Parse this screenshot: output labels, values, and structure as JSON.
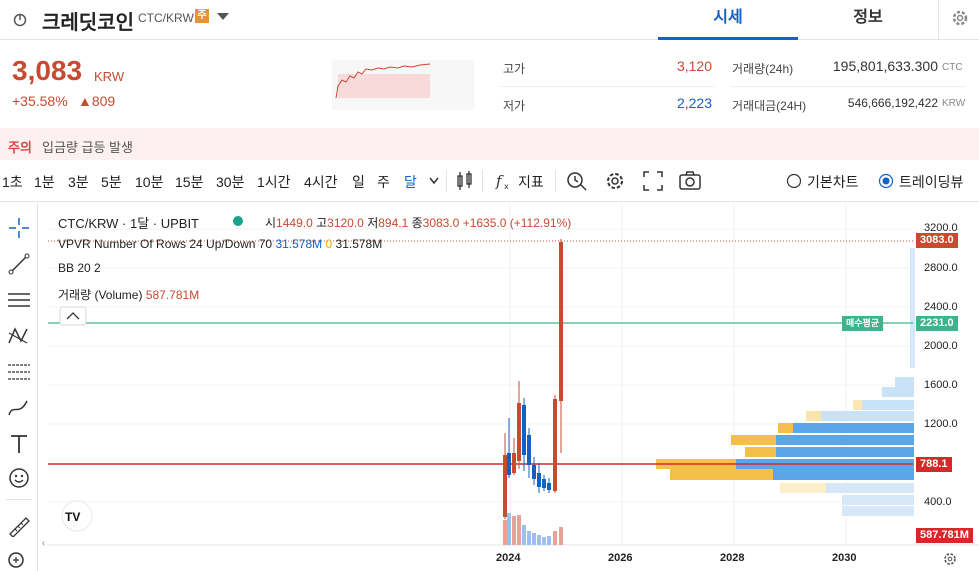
{
  "header": {
    "coin_name": "크레딧코인",
    "pair": "CTC/KRW",
    "badge": "주",
    "tabs": [
      {
        "label": "시세"
      },
      {
        "label": "정보"
      }
    ]
  },
  "ticker": {
    "price": "3,083",
    "unit": "KRW",
    "change_rate": "+35.58%",
    "change_amount": "▲809",
    "high_label": "고가",
    "high": "3,120",
    "low_label": "저가",
    "low": "2,223",
    "volume_label": "거래량(24h)",
    "volume": "195,801,633.300",
    "volume_unit": "CTC",
    "amount_label": "거래대금(24H)",
    "amount": "546,666,192,422",
    "amount_unit": "KRW"
  },
  "alert": {
    "label": "주의",
    "text": "입금량 급등 발생"
  },
  "toolbar": {
    "intervals": [
      "1초",
      "1분",
      "3분",
      "5분",
      "10분",
      "15분",
      "30분",
      "1시간",
      "4시간",
      "일",
      "주",
      "달"
    ],
    "active_interval": "달",
    "indicator_label": "지표",
    "basic_chart": "기본차트",
    "trading_view": "트레이딩뷰"
  },
  "legend": {
    "symbol": "CTC/KRW · 1달 · UPBIT",
    "open_label": "시",
    "open": "1449.0",
    "high_label": "고",
    "high": "3120.0",
    "low_label": "저",
    "low": "894.1",
    "close_label": "종",
    "close": "3083.0",
    "change": "+1635.0 (+112.91%)",
    "vpvr": "VPVR Number Of Rows 24 Up/Down 70",
    "vpvr_up": "31.578M",
    "vpvr_down": "0",
    "vpvr_total": "31.578M",
    "bb": "BB 20 2",
    "volume_label": "거래량 (Volume)",
    "volume": "587.781M"
  },
  "chart_data": {
    "type": "candlestick",
    "y_axis": [
      "3200.0",
      "2800.0",
      "2400.0",
      "2000.0",
      "1600.0",
      "1200.0",
      "400.0"
    ],
    "x_axis": [
      "2024",
      "2026",
      "2028",
      "2030"
    ],
    "ylim": [
      0,
      3300
    ],
    "price_tag": "3083.0",
    "avg_tag": "2231.0",
    "avg_label": "매수평균",
    "line_tag": "788.1",
    "volume_tag": "587.781M",
    "colors": {
      "up": "#c84a31",
      "down": "#1261c4",
      "avg": "#3fb28e"
    }
  }
}
